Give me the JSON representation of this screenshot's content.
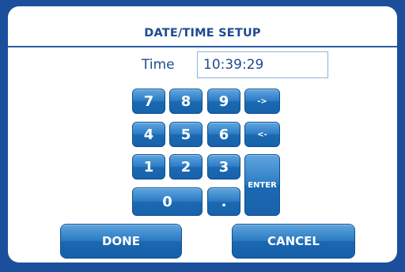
{
  "dialog": {
    "title": "DATE/TIME SETUP",
    "time_label": "Time",
    "time_value": "10:39:29"
  },
  "keypad": {
    "k7": "7",
    "k8": "8",
    "k9": "9",
    "right": "->",
    "k4": "4",
    "k5": "5",
    "k6": "6",
    "left": "<-",
    "k1": "1",
    "k2": "2",
    "k3": "3",
    "enter": "ENTER",
    "k0": "0",
    "dot": "."
  },
  "actions": {
    "done": "DONE",
    "cancel": "CANCEL"
  },
  "colors": {
    "frame": "#1b4f9c",
    "accent": "#1e4b8f",
    "button": "#2c7cc4"
  }
}
